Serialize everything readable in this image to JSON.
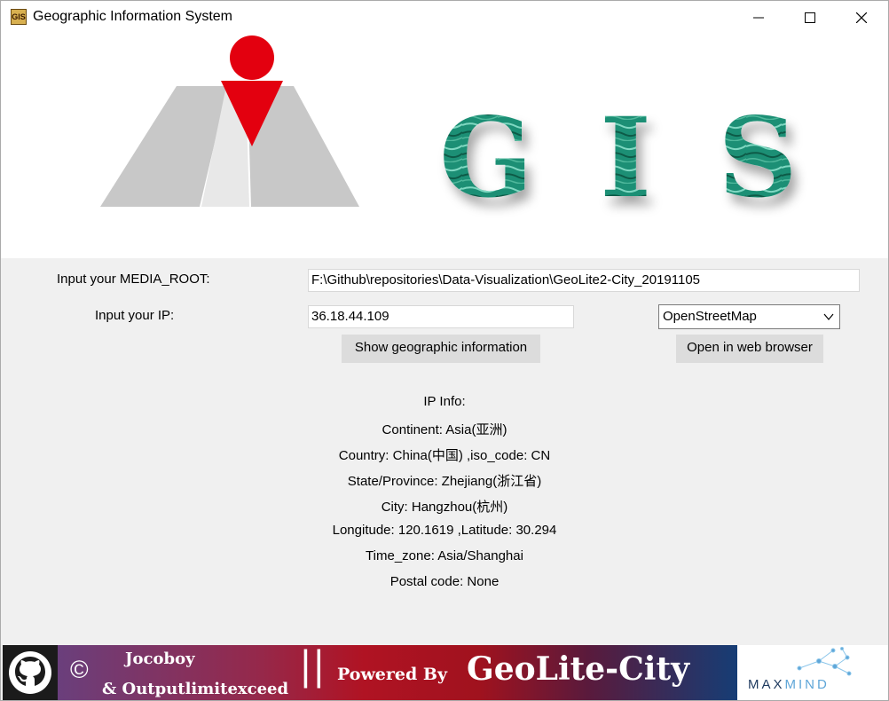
{
  "window": {
    "title": "Geographic Information System",
    "icon_text": "GIS",
    "minimize_icon": "minimize-icon",
    "maximize_icon": "maximize-icon",
    "close_icon": "close-icon"
  },
  "banner": {
    "logo_icon": "road-location-pin-logo",
    "gis_text": "G I S",
    "gis_color": "#1f8f74",
    "pin_color": "#e3000f"
  },
  "form": {
    "media_root_label": "Input your MEDIA_ROOT:",
    "media_root_value": "F:\\Github\\repositories\\Data-Visualization\\GeoLite2-City_20191105",
    "ip_label": "Input your IP:",
    "ip_value": "36.18.44.109",
    "map_select_value": "OpenStreetMap",
    "show_button": "Show geographic information",
    "open_button": "Open in web browser"
  },
  "ip_info": {
    "heading": "IP Info:",
    "continent": "Continent: Asia(亚洲)",
    "country": "Country: China(中国) ,iso_code: CN",
    "state": "State/Province: Zhejiang(浙江省)",
    "city": "City: Hangzhou(杭州)",
    "coords": "Longitude: 120.1619 ,Latitude: 30.294",
    "timezone": "Time_zone: Asia/Shanghai",
    "postal": "Postal code: None"
  },
  "footer": {
    "github_icon": "github-icon",
    "copyright_symbol": "©",
    "author1": "Jocoboy",
    "author2": "& Outputlimitexceed",
    "separator": "||",
    "powered_by": "Powered By",
    "product": "GeoLite-City",
    "maxmind_prefix": "MAX",
    "maxmind_suffix": "MIND"
  }
}
